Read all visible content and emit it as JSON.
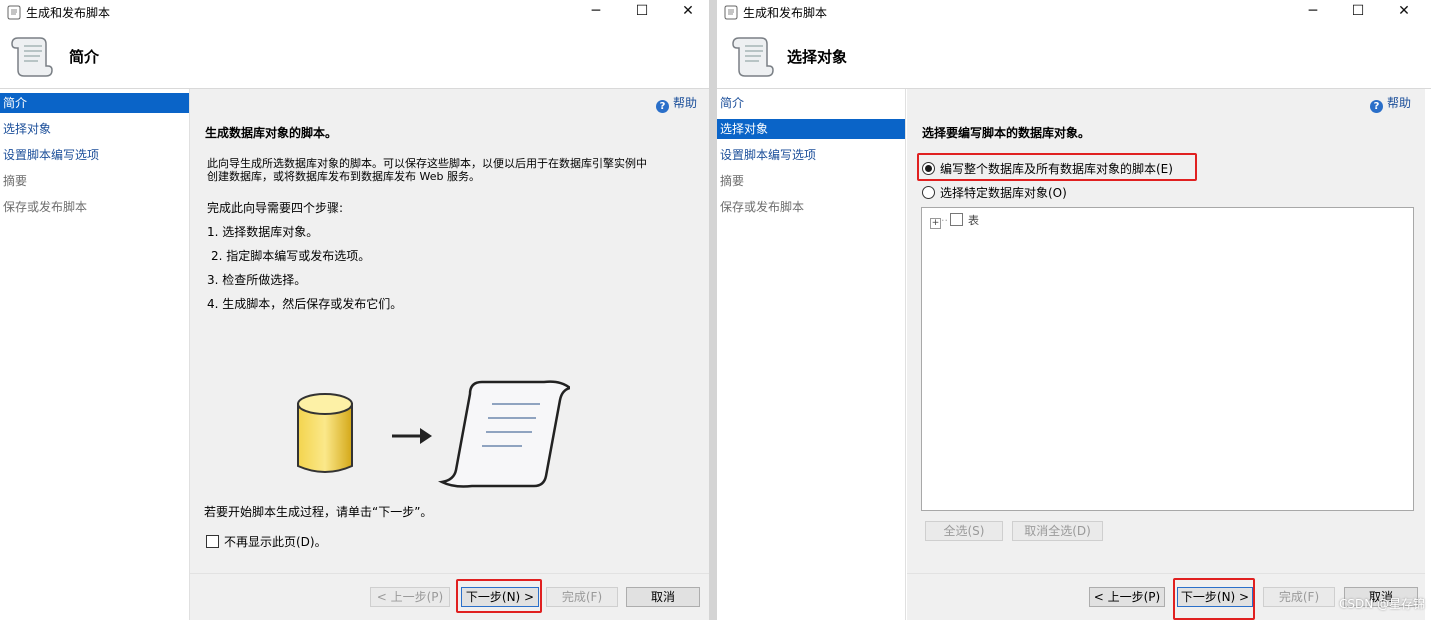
{
  "left_window": {
    "title": "生成和发布脚本",
    "header_title": "简介",
    "nav": [
      "简介",
      "选择对象",
      "设置脚本编写选项",
      "摘要",
      "保存或发布脚本"
    ],
    "help": "帮助",
    "heading": "生成数据库对象的脚本。",
    "intro_line1": "此向导生成所选数据库对象的脚本。可以保存这些脚本，以便以后用于在数据库引擎实例中",
    "intro_line2": "创建数据库，或将数据库发布到数据库发布 Web 服务。",
    "steps_title": "完成此向导需要四个步骤:",
    "steps": [
      "1. 选择数据库对象。",
      "2. 指定脚本编写或发布选项。",
      "3. 检查所做选择。",
      "4. 生成脚本，然后保存或发布它们。"
    ],
    "start_hint": "若要开始脚本生成过程，请单击“下一步”。",
    "dont_show": "不再显示此页(D)。",
    "buttons": {
      "prev": "< 上一步(P)",
      "next": "下一步(N) >",
      "finish": "完成(F)",
      "cancel": "取消"
    }
  },
  "right_window": {
    "title": "生成和发布脚本",
    "header_title": "选择对象",
    "nav": [
      "简介",
      "选择对象",
      "设置脚本编写选项",
      "摘要",
      "保存或发布脚本"
    ],
    "help": "帮助",
    "heading": "选择要编写脚本的数据库对象。",
    "option_all": "编写整个数据库及所有数据库对象的脚本(E)",
    "option_specific": "选择特定数据库对象(O)",
    "tree_item": "表",
    "select_all": "全选(S)",
    "deselect_all": "取消全选(D)",
    "buttons": {
      "prev": "< 上一步(P)",
      "next": "下一步(N) >",
      "finish": "完成(F)",
      "cancel": "取消"
    }
  },
  "watermark": "CSDN @星存锦",
  "colors": {
    "accent": "#0a64c8",
    "highlight_box": "#e02020",
    "panel": "#f0f0f0"
  }
}
